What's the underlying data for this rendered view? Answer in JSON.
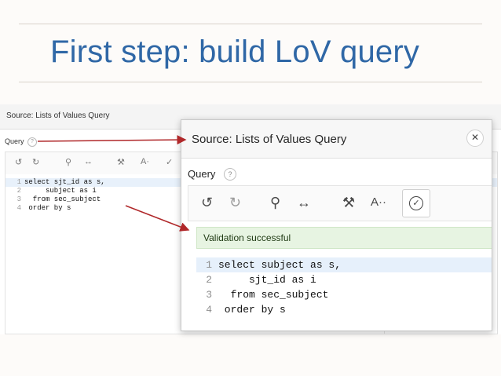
{
  "slide": {
    "title": "First step: build LoV query"
  },
  "background_screenshot": {
    "header_title": "Source: Lists of Values Query",
    "query_label": "Query",
    "help_icon": "?",
    "toolbar_icons": [
      "undo-icon",
      "redo-icon",
      "search-icon",
      "swap-icon",
      "hammer-icon",
      "font-size-icon",
      "validate-icon"
    ],
    "code": [
      {
        "num": "1",
        "text": "select sjt_id as s,"
      },
      {
        "num": "2",
        "text": "     subject as i"
      },
      {
        "num": "3",
        "text": "  from sec_subject"
      },
      {
        "num": "4",
        "text": " order by s"
      }
    ]
  },
  "dialog": {
    "title": "Source: Lists of Values Query",
    "close_symbol": "✕",
    "query_label": "Query",
    "help_icon": "?",
    "toolbar": {
      "undo": "↺",
      "redo": "↻",
      "search": "⚲",
      "swap": "↔",
      "hammer": "⚒",
      "font": "A··",
      "validate": "✓"
    },
    "success_message": "Validation successful",
    "code": [
      {
        "num": "1",
        "text": "select subject as s,"
      },
      {
        "num": "2",
        "text": "     sjt_id as i"
      },
      {
        "num": "3",
        "text": "  from sec_subject"
      },
      {
        "num": "4",
        "text": " order by s"
      }
    ]
  },
  "colors": {
    "title": "#2f67a6",
    "arrow": "#b0282a",
    "success_bg": "#e7f4e2",
    "highlight_line": "#e6f0fb"
  }
}
